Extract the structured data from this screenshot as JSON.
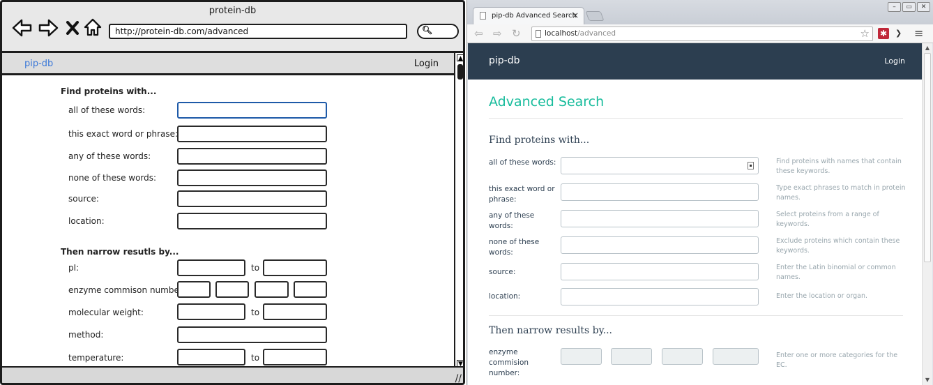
{
  "wireframe": {
    "window_title": "protein-db",
    "nav_icons": [
      "back-arrow-icon",
      "forward-arrow-icon",
      "close-x-icon",
      "home-icon"
    ],
    "url": "http://protein-db.com/advanced",
    "navbar": {
      "brand": "pip-db",
      "login": "Login"
    },
    "section1": "Find proteins with...",
    "fields1": [
      "all of these words:",
      "this exact word or phrase:",
      "any of these words:",
      "none of these words:",
      "source:",
      "location:"
    ],
    "section2": "Then narrow resutls by...",
    "fields2": [
      "pI:",
      "enzyme commison number:",
      "molecular weight:",
      "method:",
      "temperature:"
    ],
    "to": "to"
  },
  "browser": {
    "tab_title": "pip-db Advanced Search",
    "tab_close": "×",
    "address": {
      "host": "localhost",
      "path": "/advanced"
    },
    "window_controls": [
      "minimize-icon",
      "maximize-icon",
      "close-icon"
    ],
    "navbar": {
      "brand": "pip-db",
      "login": "Login"
    },
    "page_title": "Advanced Search",
    "section1": "Find proteins with...",
    "fields1": [
      {
        "label": "all of these words:",
        "help": "Find proteins with names that contain these keywords."
      },
      {
        "label": "this exact word or phrase:",
        "help": "Type exact phrases to match in protein names."
      },
      {
        "label": "any of these words:",
        "help": "Select proteins from a range of keywords."
      },
      {
        "label": "none of these words:",
        "help": "Exclude proteins which contain these keywords."
      },
      {
        "label": "source:",
        "help": "Enter the Latin binomial or common names."
      },
      {
        "label": "location:",
        "help": "Enter the location or organ."
      }
    ],
    "section2": "Then narrow results by...",
    "ec": {
      "label": "enzyme commision number:",
      "help": "Enter one or more categories for the EC."
    }
  }
}
